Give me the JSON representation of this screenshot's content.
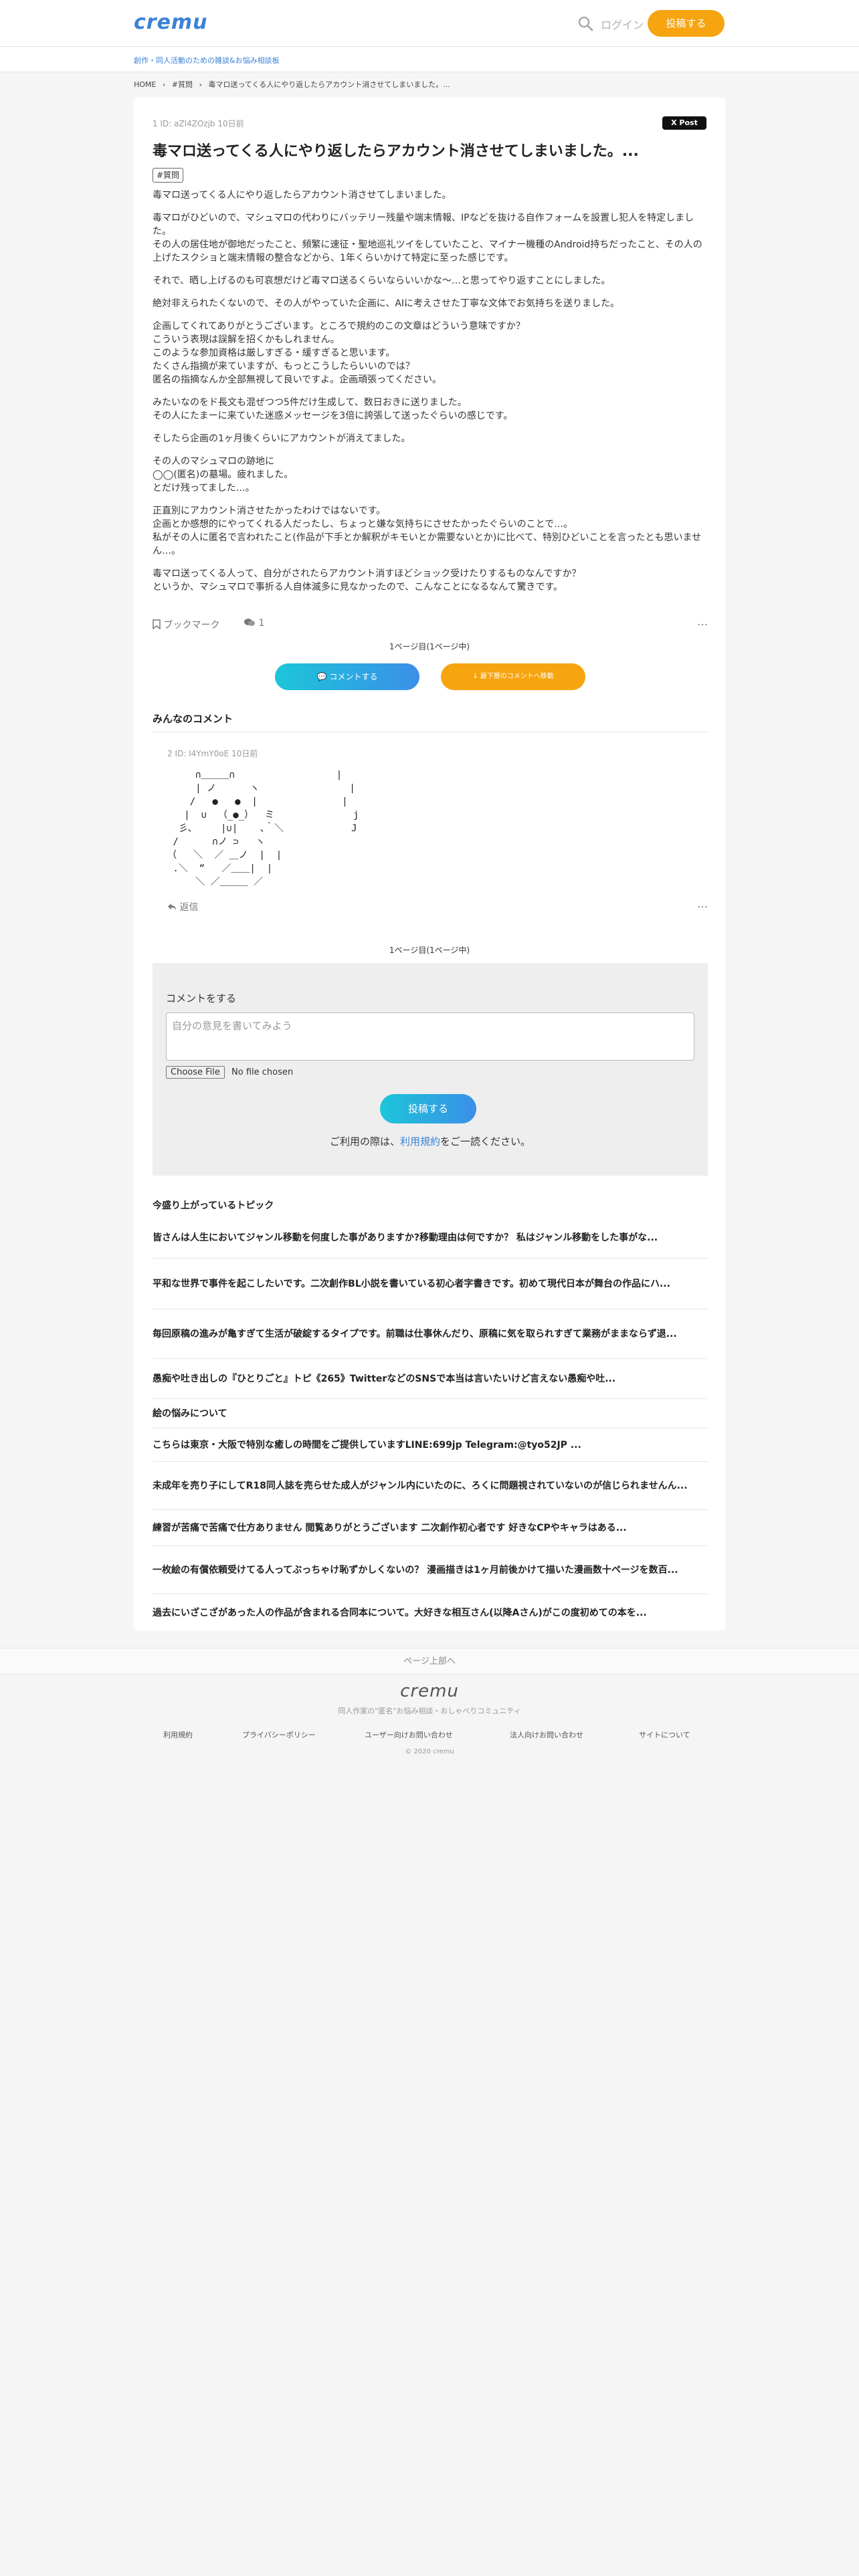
{
  "header": {
    "logo": "cremu",
    "login": "ログイン",
    "post_button": "投稿する",
    "tagline": "創作・同人活動のための雑談&お悩み相談板"
  },
  "breadcrumb": [
    "HOME",
    "›",
    "#質問",
    "›",
    "毒マロ送ってくる人にやり返したらアカウント消させてしまいました。..."
  ],
  "post": {
    "meta": "1 ID: aZl4ZOzjb 10日前",
    "tweet": "X Post",
    "title": "毒マロ送ってくる人にやり返したらアカウント消させてしまいました。...",
    "tag": "#質問",
    "paragraphs": [
      "毒マロ送ってくる人にやり返したらアカウント消させてしまいました。",
      "毒マロがひどいので、マシュマロの代わりにバッテリー残量や端末情報、IPなどを抜ける自作フォームを設置し犯人を特定しました。\nその人の居住地が御地だったこと、頻繁に速征・聖地巡礼ツイをしていたこと、マイナー機種のAndroid持ちだったこと、その人の上げたスクショと端末情報の整合などから、1年くらいかけて特定に至った感じです。",
      "それで、晒し上げるのも可哀想だけど毒マロ送るくらいならいいかな〜…と思ってやり返すことにしました。",
      "絶対非えられたくないので、その人がやっていた企画に、AIに考えさせた丁寧な文体でお気持ちを送りました。",
      "企画してくれてありがとうございます。ところで規約のこの文章はどういう意味ですか？\nこういう表現は誤解を招くかもしれません。\nこのような参加資格は厳しすぎる・緩すぎると思います。\nたくさん指摘が来ていますが、もっとこうしたらいいのでは？\n匿名の指摘なんか全部無視して良いですよ。企画頑張ってください。",
      "みたいなのをド長文も混ぜつつ5件だけ生成して、数日おきに送りました。\nその人にたまーに来ていた迷惑メッセージを3倍に誇張して送ったぐらいの感じです。",
      "そしたら企画の1ヶ月後くらいにアカウントが消えてました。",
      "その人のマシュマロの跡地に\n◯◯(匿名)の墓場。疲れました。\nとだけ残ってました…。",
      "正直別にアカウント消させたかったわけではないです。\n企画とか感想的にやってくれる人だったし、ちょっと嫌な気持ちにさせたかったぐらいのことで…。\n私がその人に匿名で言われたこと(作品が下手とか解釈がキモいとか需要ないとか)に比べて、特別ひどいことを言ったとも思いません…。",
      "毒マロ送ってくる人って、自分がされたらアカウント消すほどショック受けたりするものなんですか？\nというか、マシュマロで事折る人自体滅多に見なかったので、こんなことになるなんて驚きです。"
    ],
    "bookmark": "ブックマーク",
    "comment_count": "1",
    "more": "…"
  },
  "pagination": {
    "top": "1ページ目(1ページ中)",
    "bottom": "1ページ目(1ページ中)"
  },
  "buttons": {
    "comment": "💬 コメントする",
    "latest": "↓ 最下層のコメントへ移動"
  },
  "comments_section": {
    "title": "みんなのコメント",
    "items": [
      {
        "meta": "2 ID: I4YmY0oE 10日前",
        "aa": "     ∩＿＿＿∩                  |\n     | ノ      ヽ                |\n    /   ●   ●  |               |\n   |  ∪  （_●_）  ミ              j\n  彡､     |∪|    ､｀＼            J\n /      ∩ノ ⊃   ヽ\n（   ＼  ／ ＿ノ  |  |\n .＼  “   ／＿＿|  |\n     ＼ ／＿＿＿ ／",
        "reply": "返信",
        "more": "…"
      }
    ]
  },
  "form": {
    "title": "コメントをする",
    "placeholder": "自分の意見を書いてみよう",
    "choose_file": "Choose File",
    "no_file": "No file chosen",
    "submit": "投稿する",
    "terms_pre": "ご利用の際は、",
    "terms_link": "利用規約",
    "terms_post": "をご一読ください。"
  },
  "topics": {
    "title": "今盛り上がっているトピック",
    "items": [
      "皆さんは人生においてジャンル移動を何度した事がありますか?移動理由は何ですか？ 私はジャンル移動をした事がな...",
      "平和な世界で事件を起こしたいです。二次創作BL小説を書いている初心者字書きです。初めて現代日本が舞台の作品にハ...",
      "毎回原稿の進みが亀すぎて生活が破綻するタイプです。前職は仕事休んだり、原稿に気を取られすぎて業務がままならず退...",
      "愚痴や吐き出しの『ひとりごと』トピ《265》TwitterなどのSNSで本当は言いたいけど言えない愚痴や吐...",
      "絵の悩みについて",
      "こちらは東京・大阪で特別な癒しの時間をご提供していますLINE:699jp Telegram:@tyo52JP ...",
      "未成年を売り子にしてR18同人誌を売らせた成人がジャンル内にいたのに、ろくに問題視されていないのが信じられませんん...",
      "練習が苦痛で苦痛で仕方ありません 閲覧ありがとうございます 二次創作初心者です 好きなCPやキャラはある...",
      "一枚絵の有償依頼受けてる人ってぶっちゃけ恥ずかしくないの？ 漫画描きは1ヶ月前後かけて描いた漫画数十ページを数百...",
      "過去にいざこざがあった人の作品が含まれる合同本について。大好きな相互さん(以降Aさん)がこの度初めての本を..."
    ]
  },
  "back_top": "ページ上部へ",
  "footer": {
    "logo": "cremu",
    "sub": "同人作家の\"匿名\"お悩み相談・おしゃべりコミュニティ",
    "links": [
      "利用規約",
      "プライバシーポリシー",
      "ユーザー向けお問い合わせ",
      "法人向けお問い合わせ",
      "サイトについて"
    ],
    "copy": "© 2020 cremu"
  }
}
